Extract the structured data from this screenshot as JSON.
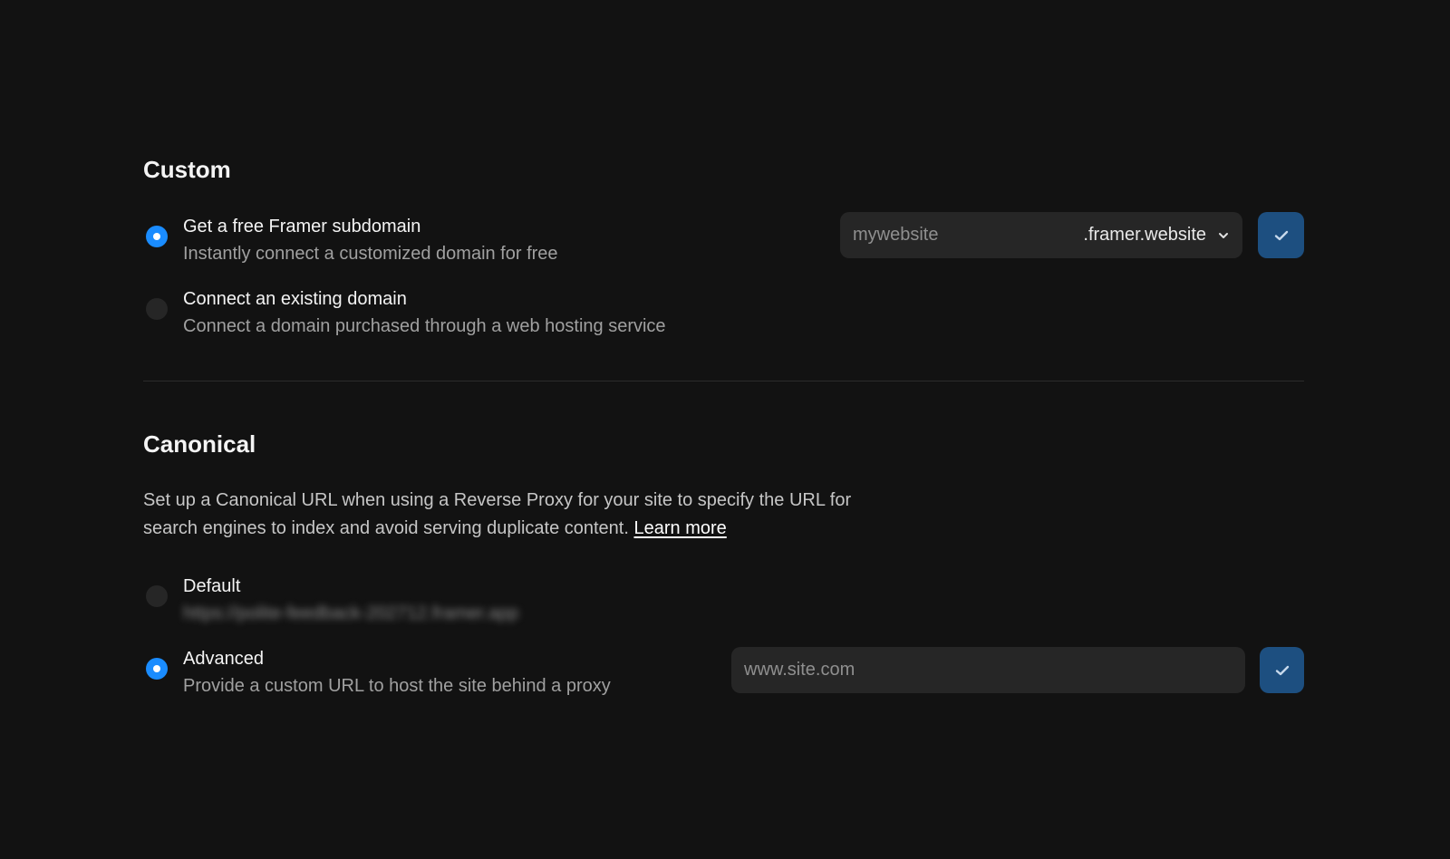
{
  "custom": {
    "title": "Custom",
    "options": [
      {
        "label": "Get a free Framer subdomain",
        "description": "Instantly connect a customized domain for free",
        "selected": true
      },
      {
        "label": "Connect an existing domain",
        "description": "Connect a domain purchased through a web hosting service",
        "selected": false
      }
    ],
    "subdomain_input": {
      "value": "",
      "placeholder": "mywebsite",
      "suffix": ".framer.website",
      "suffix_icon": "chevron-down-icon"
    },
    "confirm_icon": "checkmark-icon"
  },
  "canonical": {
    "title": "Canonical",
    "description": "Set up a Canonical URL when using a Reverse Proxy for your site to specify the URL for search engines to index and avoid serving duplicate content.",
    "learn_more": "Learn more",
    "options": [
      {
        "label": "Default",
        "description": "https://polite-feedback-202712.framer.app",
        "selected": false
      },
      {
        "label": "Advanced",
        "description": "Provide a custom URL to host the site behind a proxy",
        "selected": true
      }
    ],
    "url_input": {
      "value": "",
      "placeholder": "www.site.com"
    },
    "confirm_icon": "checkmark-icon"
  },
  "colors": {
    "background": "#121212",
    "accent": "#1a8cff",
    "confirm_button": "#1d4f80",
    "field_background": "#262626"
  }
}
